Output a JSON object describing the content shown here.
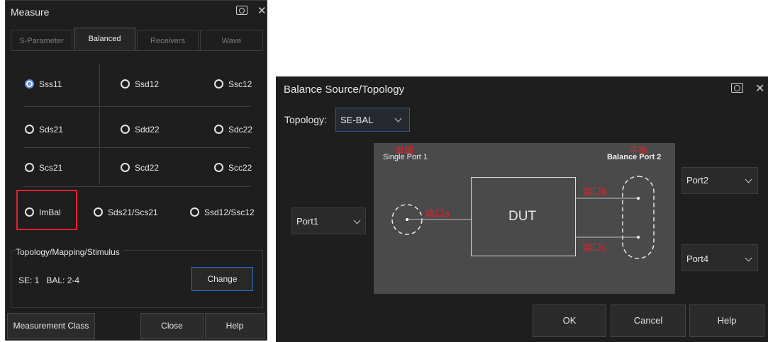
{
  "measure": {
    "title": "Measure",
    "tabs": [
      "S-Parameter",
      "Balanced",
      "Receivers",
      "Wave"
    ],
    "options": [
      {
        "label": "Sss11",
        "selected": true
      },
      {
        "label": "Ssd12",
        "selected": false
      },
      {
        "label": "Ssc12",
        "selected": false
      },
      {
        "label": "Sds21",
        "selected": false
      },
      {
        "label": "Sdd22",
        "selected": false
      },
      {
        "label": "Sdc22",
        "selected": false
      },
      {
        "label": "Scs21",
        "selected": false
      },
      {
        "label": "Scd22",
        "selected": false
      },
      {
        "label": "Scc22",
        "selected": false
      },
      {
        "label": "ImBal",
        "selected": false
      },
      {
        "label": "Sds21/Scs21",
        "selected": false
      },
      {
        "label": "Ssd12/Ssc12",
        "selected": false
      }
    ],
    "group_title": "Topology/Mapping/Stimulus",
    "se_label": "SE: 1",
    "bal_label": "BAL: 2-4",
    "change_label": "Change",
    "footer": {
      "measurement_class": "Measurement Class",
      "close": "Close",
      "help": "Help"
    }
  },
  "balance": {
    "title": "Balance Source/Topology",
    "topology_label": "Topology:",
    "topology_value": "SE-BAL",
    "port1": "Port1",
    "port2": "Port2",
    "port4": "Port4",
    "diagram": {
      "single_cn": "单端",
      "single_label": "Single Port 1",
      "balance_cn": "平衡",
      "balance_label": "Balance Port 2",
      "port_a": "端口a",
      "port_b": "端口b",
      "port_c": "端口c",
      "dut": "DUT"
    },
    "buttons": {
      "ok": "OK",
      "cancel": "Cancel",
      "help": "Help"
    }
  },
  "colors": {
    "accent": "#5a8de6",
    "highlight": "#e0212b",
    "focus": "#2b6fc7"
  }
}
